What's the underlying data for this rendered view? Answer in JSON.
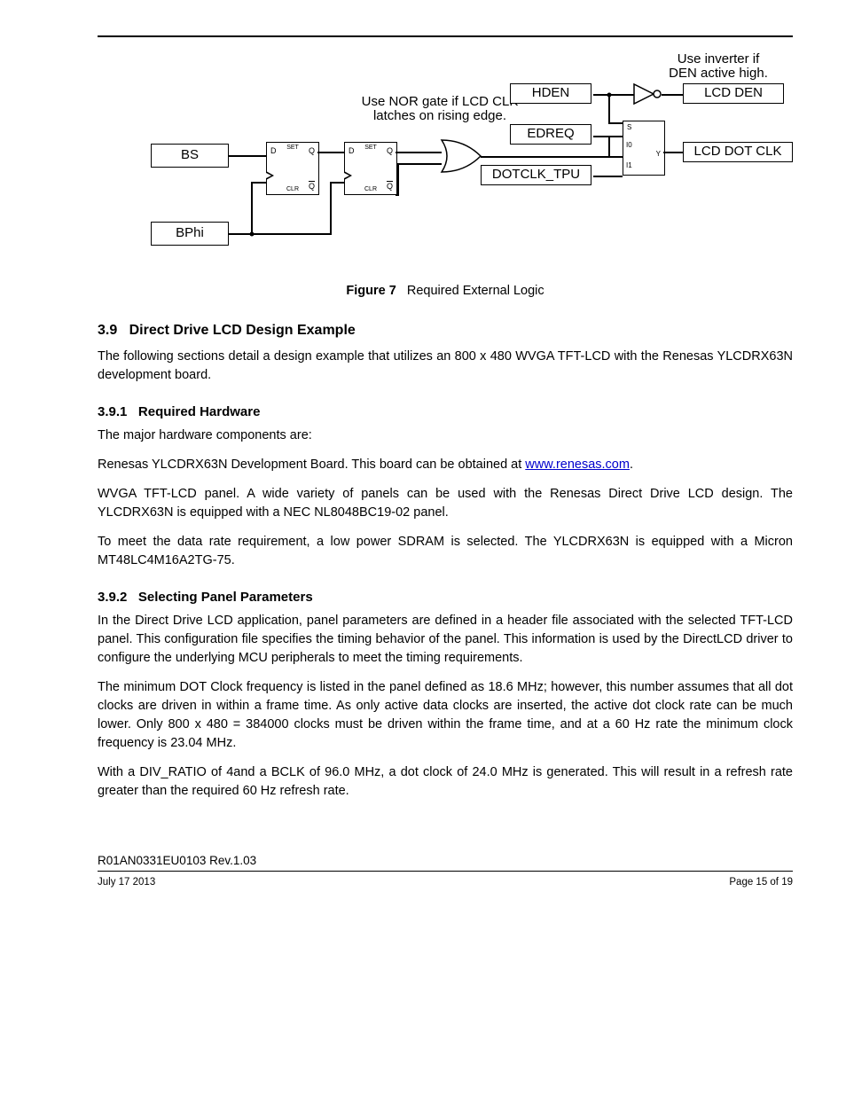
{
  "diagram": {
    "note_inverter_l1": "Use inverter if",
    "note_inverter_l2": "DEN active high.",
    "note_nor_l1": "Use NOR gate if LCD CLK",
    "note_nor_l2": "latches on rising edge.",
    "sig_bs": "BS",
    "sig_bphi": "BPhi",
    "sig_hden": "HDEN",
    "sig_edreq": "EDREQ",
    "sig_dotclk": "DOTCLK_TPU",
    "out_lcd_den": "LCD DEN",
    "out_lcd_dotclk": "LCD DOT CLK",
    "ff_d": "D",
    "ff_set": "SET",
    "ff_q": "Q",
    "ff_clr": "CLR",
    "ff_qb": "Q",
    "mux_s": "S",
    "mux_i0": "I0",
    "mux_i1": "I1",
    "mux_y": "Y"
  },
  "fig": {
    "label": "Figure 7",
    "title": "Required External Logic"
  },
  "sections": {
    "s39": {
      "num": "3.9",
      "title": "Direct Drive LCD Design Example"
    },
    "s39_p1": "The following sections detail a design example that utilizes an 800 x 480 WVGA TFT-LCD with the Renesas YLCDRX63N development board.",
    "s391": {
      "num": "3.9.1",
      "title": "Required Hardware"
    },
    "s391_p1": "The major hardware components are:",
    "s391_li1_a": "Renesas ",
    "s391_li1_b": "YLCDRX63N",
    "s391_li1_c": " Development Board. This board can be obtained at ",
    "s391_li1_link": "www.renesas.com",
    "s391_li1_d": ".",
    "s391_li2": "WVGA TFT-LCD panel. A wide variety of panels can be used with the Renesas Direct Drive LCD design. The YLCDRX63N is equipped with a NEC NL8048BC19-02 panel.",
    "s391_li3": "To meet the data rate requirement, a low power SDRAM is selected. The YLCDRX63N is equipped with a Micron MT48LC4M16A2TG-75.",
    "s392": {
      "num": "3.9.2",
      "title": "Selecting Panel Parameters"
    },
    "s392_p1": "In the Direct Drive LCD application, panel parameters are defined in a header file associated with the selected TFT-LCD panel. This configuration file specifies the timing behavior of the panel. This information is used by the DirectLCD driver to configure the underlying MCU peripherals to meet the timing requirements.",
    "s392_p2": "The minimum DOT Clock frequency is listed in the panel defined as 18.6 MHz; however, this number assumes that all dot clocks are driven in within a frame time. As only active data clocks are inserted, the active dot clock rate can be much lower. Only 800 x 480 = 384000 clocks must be driven within the frame time, and at a 60 Hz rate the minimum clock frequency is 23.04 MHz.",
    "s392_p3": "With a DIV_RATIO of 4and a BCLK of 96.0 MHz, a dot clock of 24.0 MHz is generated. This will result in a refresh rate greater than the required 60 Hz refresh rate."
  },
  "footer": {
    "note": "R01AN0331EU0103 Rev.1.03",
    "left": "July 17 2013",
    "right": "Page 15 of 19"
  }
}
